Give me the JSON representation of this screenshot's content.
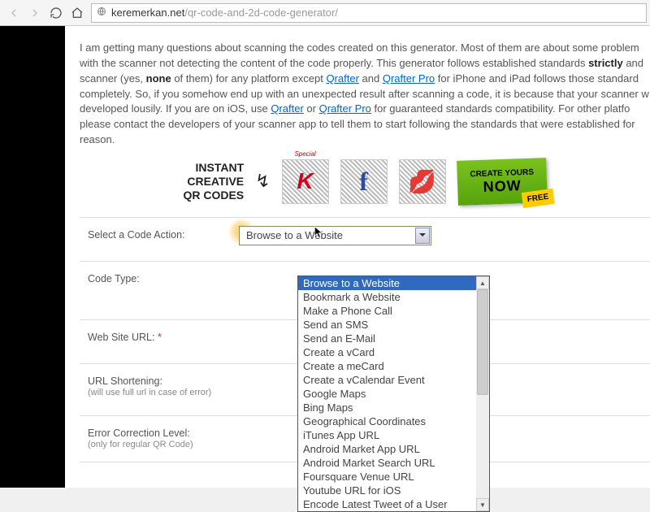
{
  "browser": {
    "url_host": "keremerkan.net",
    "url_path": "/qr-code-and-2d-code-generator/"
  },
  "intro": {
    "p1a": "I am getting many questions about scanning the codes created on this generator. Most of them are about some problem with the scanner not detecting the content of the code properly. This generator follows established standards ",
    "strictly": "strictly",
    "p1b": " and scanner (yes, ",
    "none": "none",
    "p1c": " of them) for any platform except ",
    "qrafter": "Qrafter",
    "and": " and ",
    "qrafterpro": "Qrafter Pro",
    "p1d": " for iPhone and iPad follows those standard completely. So, if you somehow end up with an unexpected result after scanning a code, it is because that your scanner w developed lousily. If you are on iOS, use ",
    "or": " or ",
    "p1e": " for guaranteed standards compatibility. For other platfo please contact the developers of your scanner app to tell them to start following the standards that were established for reason."
  },
  "banner": {
    "l1": "INSTANT",
    "l2": "CREATIVE",
    "l3": "QR CODES",
    "special": "Special",
    "cta_l1": "CREATE YOURS",
    "cta_l2": "NOW",
    "cta_free": "FREE"
  },
  "form": {
    "code_action_label": "Select a Code Action:",
    "code_action_value": "Browse to a Website",
    "code_type_label": "Code Type:",
    "url_label": "Web Site URL:",
    "url_req": "*",
    "shortening_label": "URL Shortening:",
    "shortening_sub": "(will use full url in case of error)",
    "ecc_label": "Error Correction Level:",
    "ecc_sub": "(only for regular QR Code)"
  },
  "dropdown": {
    "items": [
      "Browse to a Website",
      "Bookmark a Website",
      "Make a Phone Call",
      "Send an SMS",
      "Send an E-Mail",
      "Create a vCard",
      "Create a meCard",
      "Create a vCalendar Event",
      "Google Maps",
      "Bing Maps",
      "Geographical Coordinates",
      "iTunes App URL",
      "Android Market App URL",
      "Android Market Search URL",
      "Foursquare Venue URL",
      "Youtube URL for iOS",
      "Encode Latest Tweet of a User"
    ]
  }
}
